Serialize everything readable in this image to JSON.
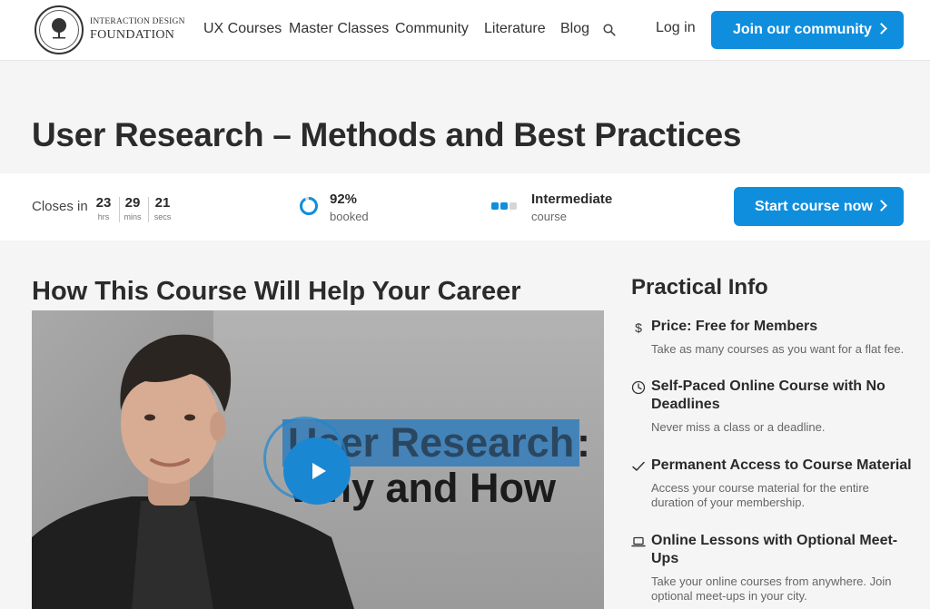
{
  "nav": {
    "logo_line1": "INTERACTION DESIGN",
    "logo_line2": "FOUNDATION",
    "links": [
      "UX Courses",
      "Master Classes",
      "Community",
      "Literature",
      "Blog"
    ],
    "login": "Log in",
    "join": "Join our community"
  },
  "course": {
    "title": "User Research – Methods and Best Practices"
  },
  "stats": {
    "closes_label": "Closes in",
    "countdown": [
      {
        "value": "23",
        "unit": "hrs"
      },
      {
        "value": "29",
        "unit": "mins"
      },
      {
        "value": "21",
        "unit": "secs"
      }
    ],
    "booked_value": "92%",
    "booked_label": "booked",
    "booked_fraction": 0.92,
    "level_value": "Intermediate",
    "level_label": "course",
    "level_filled_of": [
      2,
      3
    ],
    "start": "Start course now"
  },
  "main": {
    "section_title": "How This Course Will Help Your Career",
    "video": {
      "line1": "User Research",
      "line1_colon": ":",
      "line2": "Why and How"
    }
  },
  "practical": {
    "title": "Practical Info",
    "items": [
      {
        "icon": "dollar-icon",
        "head": "Price: Free for Members",
        "desc": "Take as many courses as you want for a flat fee."
      },
      {
        "icon": "clock-icon",
        "head": "Self-Paced Online Course with No Deadlines",
        "desc": "Never miss a class or a deadline."
      },
      {
        "icon": "checkmark-icon",
        "head": "Permanent Access to Course Material",
        "desc": "Access your course material for the entire duration of your membership."
      },
      {
        "icon": "laptop-icon",
        "head": "Online Lessons with Optional Meet-Ups",
        "desc": "Take your online courses from anywhere. Join optional meet-ups in your city."
      }
    ]
  },
  "colors": {
    "accent": "#0f8ede",
    "background": "#f5f5f5",
    "text": "#2a2a2a"
  }
}
